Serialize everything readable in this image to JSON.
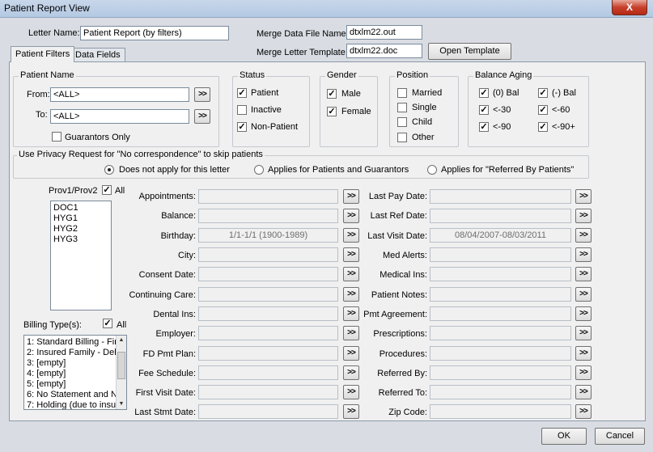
{
  "window": {
    "title": "Patient Report View",
    "close_glyph": "X"
  },
  "top": {
    "letter_name_label": "Letter Name:",
    "letter_name_value": "Patient Report (by filters)",
    "merge_file_label": "Merge Data File Name:",
    "merge_file_value": "dtxlm22.out",
    "merge_template_label": "Merge Letter Template:",
    "merge_template_value": "dtxlm22.doc",
    "open_template_label": "Open Template"
  },
  "tabs": [
    {
      "label": "Patient Filters",
      "active": true
    },
    {
      "label": "Data Fields",
      "active": false
    }
  ],
  "patient_name": {
    "title": "Patient Name",
    "from_label": "From:",
    "from_value": "<ALL>",
    "to_label": "To:",
    "to_value": "<ALL>",
    "browse_label": ">>",
    "guarantors_only_label": "Guarantors Only",
    "guarantors_only_checked": false
  },
  "status": {
    "title": "Status",
    "items": [
      {
        "label": "Patient",
        "checked": true
      },
      {
        "label": "Inactive",
        "checked": false
      },
      {
        "label": "Non-Patient",
        "checked": true
      }
    ]
  },
  "gender": {
    "title": "Gender",
    "items": [
      {
        "label": "Male",
        "checked": true
      },
      {
        "label": "Female",
        "checked": true
      }
    ]
  },
  "position": {
    "title": "Position",
    "items": [
      {
        "label": "Married",
        "checked": false
      },
      {
        "label": "Single",
        "checked": false
      },
      {
        "label": "Child",
        "checked": false
      },
      {
        "label": "Other",
        "checked": false
      }
    ]
  },
  "balance_aging": {
    "title": "Balance Aging",
    "items": [
      {
        "label": "(0) Bal",
        "checked": true
      },
      {
        "label": "(-) Bal",
        "checked": true
      },
      {
        "label": "<-30",
        "checked": true
      },
      {
        "label": "<-60",
        "checked": true
      },
      {
        "label": "<-90",
        "checked": true
      },
      {
        "label": "<-90+",
        "checked": true
      }
    ]
  },
  "privacy": {
    "title": "Use Privacy Request for \"No correspondence\" to skip patients",
    "options": [
      {
        "label": "Does not apply for this letter",
        "selected": true
      },
      {
        "label": "Applies for Patients and Guarantors",
        "selected": false
      },
      {
        "label": "Applies for \"Referred By Patients\"",
        "selected": false
      }
    ]
  },
  "providers": {
    "label": "Prov1/Prov2",
    "all_label": "All",
    "all_checked": true,
    "items": [
      "DOC1",
      "HYG1",
      "HYG2",
      "HYG3"
    ]
  },
  "billing": {
    "label": "Billing Type(s):",
    "all_label": "All",
    "all_checked": true,
    "items": [
      "1: Standard Billing - Fir",
      "2: Insured Family - Del",
      "3: [empty]",
      "4: [empty]",
      "5: [empty]",
      "6: No Statement and N",
      "7: Holding (due to insu"
    ]
  },
  "filters_left": [
    {
      "label": "Appointments:",
      "value": ""
    },
    {
      "label": "Balance:",
      "value": ""
    },
    {
      "label": "Birthday:",
      "value": "1/1-1/1 (1900-1989)"
    },
    {
      "label": "City:",
      "value": ""
    },
    {
      "label": "Consent Date:",
      "value": ""
    },
    {
      "label": "Continuing Care:",
      "value": ""
    },
    {
      "label": "Dental Ins:",
      "value": ""
    },
    {
      "label": "Employer:",
      "value": ""
    },
    {
      "label": "FD Pmt Plan:",
      "value": ""
    },
    {
      "label": "Fee Schedule:",
      "value": ""
    },
    {
      "label": "First Visit Date:",
      "value": ""
    },
    {
      "label": "Last Stmt Date:",
      "value": ""
    }
  ],
  "filters_right": [
    {
      "label": "Last Pay Date:",
      "value": ""
    },
    {
      "label": "Last Ref Date:",
      "value": ""
    },
    {
      "label": "Last Visit Date:",
      "value": "08/04/2007-08/03/2011"
    },
    {
      "label": "Med Alerts:",
      "value": ""
    },
    {
      "label": "Medical Ins:",
      "value": ""
    },
    {
      "label": "Patient Notes:",
      "value": ""
    },
    {
      "label": "Pmt Agreement:",
      "value": ""
    },
    {
      "label": "Prescriptions:",
      "value": ""
    },
    {
      "label": "Procedures:",
      "value": ""
    },
    {
      "label": "Referred By:",
      "value": ""
    },
    {
      "label": "Referred To:",
      "value": ""
    },
    {
      "label": "Zip Code:",
      "value": ""
    }
  ],
  "browse_label": ">>",
  "footer": {
    "ok_label": "OK",
    "cancel_label": "Cancel"
  }
}
